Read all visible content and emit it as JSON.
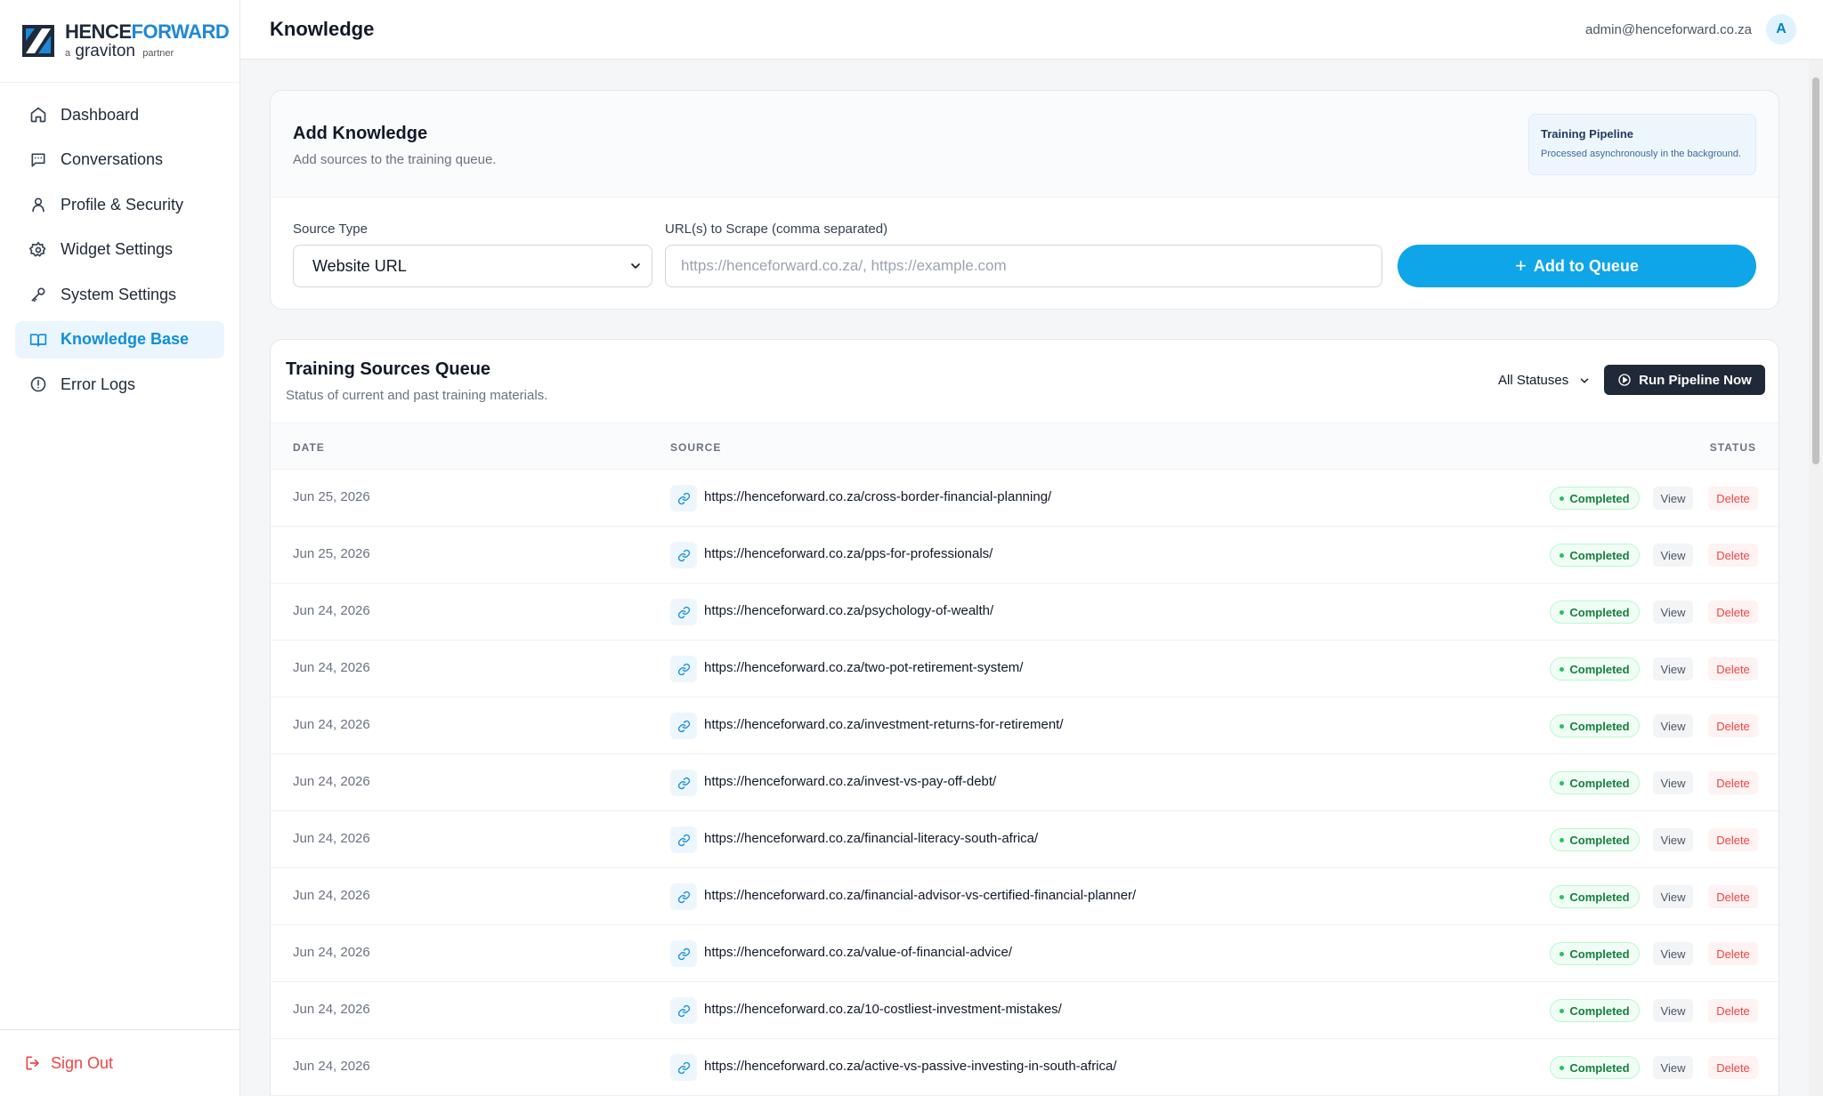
{
  "brand": {
    "name_part1": "HENCE",
    "name_part2": "FORWARD",
    "sub_prefix": "a",
    "sub_main": "graviton",
    "sub_suffix": "partner"
  },
  "sidebar": {
    "items": [
      {
        "label": "Dashboard",
        "icon": "home-icon"
      },
      {
        "label": "Conversations",
        "icon": "chat-icon"
      },
      {
        "label": "Profile & Security",
        "icon": "user-icon"
      },
      {
        "label": "Widget Settings",
        "icon": "gear-icon"
      },
      {
        "label": "System Settings",
        "icon": "key-icon"
      },
      {
        "label": "Knowledge Base",
        "icon": "book-icon",
        "active": true
      },
      {
        "label": "Error Logs",
        "icon": "alert-icon"
      }
    ],
    "sign_out": "Sign Out"
  },
  "header": {
    "title": "Knowledge",
    "user_email": "admin@henceforward.co.za",
    "avatar_initial": "A"
  },
  "add_knowledge": {
    "title": "Add Knowledge",
    "subtitle": "Add sources to the training queue.",
    "pipeline_note": {
      "title": "Training Pipeline",
      "text": "Processed asynchronously in the background."
    },
    "source_type_label": "Source Type",
    "source_type_value": "Website URL",
    "url_label": "URL(s) to Scrape (comma separated)",
    "url_placeholder": "https://henceforward.co.za/, https://example.com",
    "add_button": "Add to Queue"
  },
  "queue": {
    "title": "Training Sources Queue",
    "subtitle": "Status of current and past training materials.",
    "filter_value": "All Statuses",
    "run_button": "Run Pipeline Now",
    "columns": {
      "date": "DATE",
      "source": "SOURCE",
      "status": "STATUS"
    },
    "view_label": "View",
    "delete_label": "Delete",
    "rows": [
      {
        "date": "Jun 25, 2026",
        "source": "https://henceforward.co.za/cross-border-financial-planning/",
        "status": "Completed"
      },
      {
        "date": "Jun 25, 2026",
        "source": "https://henceforward.co.za/pps-for-professionals/",
        "status": "Completed"
      },
      {
        "date": "Jun 24, 2026",
        "source": "https://henceforward.co.za/psychology-of-wealth/",
        "status": "Completed"
      },
      {
        "date": "Jun 24, 2026",
        "source": "https://henceforward.co.za/two-pot-retirement-system/",
        "status": "Completed"
      },
      {
        "date": "Jun 24, 2026",
        "source": "https://henceforward.co.za/investment-returns-for-retirement/",
        "status": "Completed"
      },
      {
        "date": "Jun 24, 2026",
        "source": "https://henceforward.co.za/invest-vs-pay-off-debt/",
        "status": "Completed"
      },
      {
        "date": "Jun 24, 2026",
        "source": "https://henceforward.co.za/financial-literacy-south-africa/",
        "status": "Completed"
      },
      {
        "date": "Jun 24, 2026",
        "source": "https://henceforward.co.za/financial-advisor-vs-certified-financial-planner/",
        "status": "Completed"
      },
      {
        "date": "Jun 24, 2026",
        "source": "https://henceforward.co.za/value-of-financial-advice/",
        "status": "Completed"
      },
      {
        "date": "Jun 24, 2026",
        "source": "https://henceforward.co.za/10-costliest-investment-mistakes/",
        "status": "Completed"
      },
      {
        "date": "Jun 24, 2026",
        "source": "https://henceforward.co.za/active-vs-passive-investing-in-south-africa/",
        "status": "Completed"
      }
    ]
  },
  "colors": {
    "accent": "#0ea5e9",
    "active_nav": "#0f8fd8",
    "danger": "#ef4444",
    "success": "#15803d",
    "dark_button": "#1f2937"
  }
}
